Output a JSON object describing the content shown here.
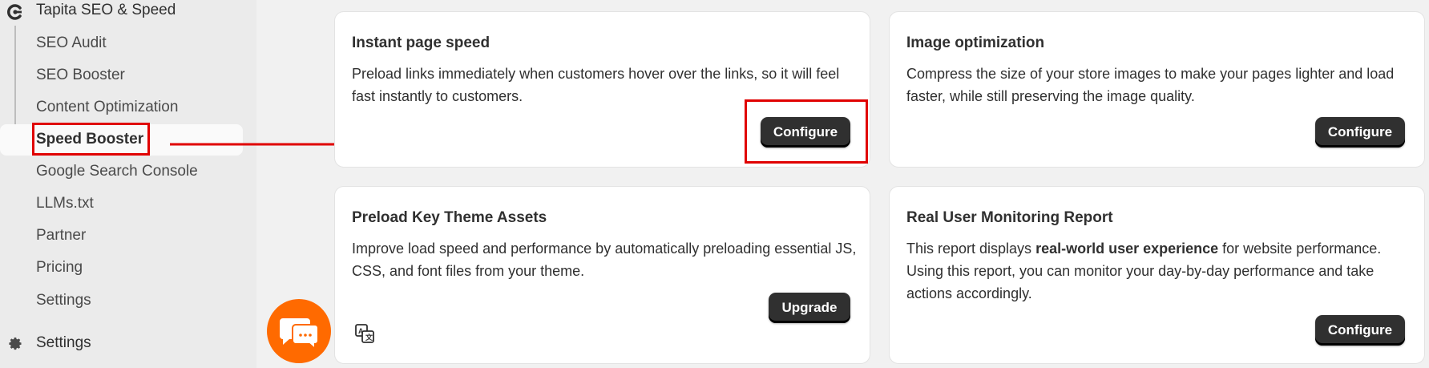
{
  "app": {
    "title": "Tapita SEO & Speed"
  },
  "sidebar": {
    "items": [
      {
        "label": "SEO Audit"
      },
      {
        "label": "SEO Booster"
      },
      {
        "label": "Content Optimization"
      },
      {
        "label": "Speed Booster"
      },
      {
        "label": "Google Search Console"
      },
      {
        "label": "LLMs.txt"
      },
      {
        "label": "Partner"
      },
      {
        "label": "Pricing"
      },
      {
        "label": "Settings"
      }
    ],
    "active_item": "Speed Booster",
    "settings_label": "Settings"
  },
  "cards": [
    {
      "title": "Instant page speed",
      "description": "Preload links immediately when customers hover over the links, so it will feel fast instantly to customers.",
      "button": "Configure"
    },
    {
      "title": "Image optimization",
      "description": "Compress the size of your store images to make your pages lighter and load faster, while still preserving the image quality.",
      "button": "Configure"
    },
    {
      "title": "Preload Key Theme Assets",
      "description": "Improve load speed and performance by automatically preloading essential JS, CSS, and font files from your theme.",
      "button": "Upgrade"
    },
    {
      "title": "Real User Monitoring Report",
      "description_prefix": "This report displays ",
      "description_bold": "real-world user experience",
      "description_suffix": " for website performance. Using this report, you can monitor your day-by-day performance and take actions accordingly.",
      "button": "Configure"
    }
  ],
  "colors": {
    "annotation_red": "#e00000",
    "chat_orange": "#ff6a00",
    "button_dark": "#303030"
  },
  "icons": [
    "app-logo-icon",
    "settings-gear-icon",
    "translate-icon",
    "chat-icon"
  ]
}
